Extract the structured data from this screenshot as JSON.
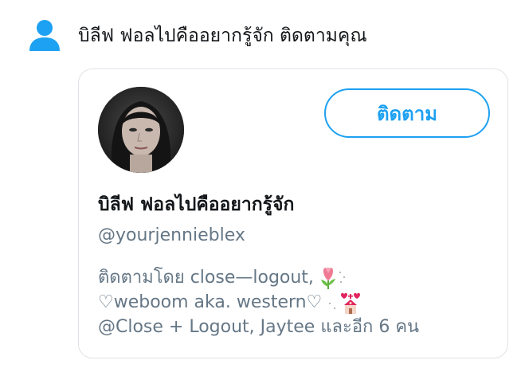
{
  "notification": {
    "icon": "person-icon",
    "text": "บิลีฟ ฟอลไปคืออยากรู้จัก ติดตามคุณ"
  },
  "card": {
    "follow_button_label": "ติดตาม",
    "display_name": "บิลีฟ ฟอลไปคืออยากรู้จัก",
    "handle": "@yourjennieblex",
    "followed_by": {
      "line1": "ติดตามโดย close—logout,",
      "line2": "♡weboom aka. western♡",
      "line3": "@Close + Logout, Jaytee และอีก 6 คน"
    }
  },
  "colors": {
    "accent": "#1da1f2",
    "text_primary": "#14171a",
    "text_secondary": "#657786",
    "border": "#dfe3e7"
  }
}
